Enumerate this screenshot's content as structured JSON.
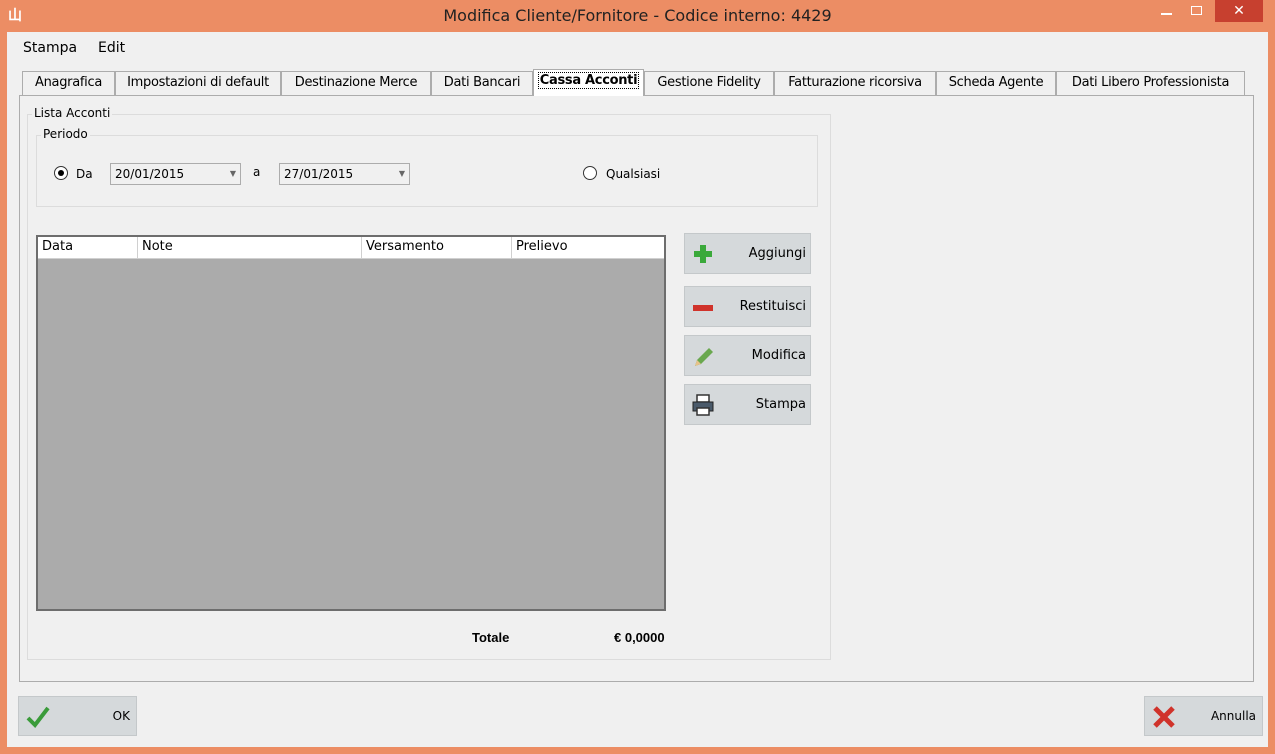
{
  "window": {
    "title": "Modifica Cliente/Fornitore - Codice interno: 4429",
    "icon_glyph": "山",
    "minimize": "minimize-icon",
    "maximize": "maximize-icon",
    "close_glyph": "✕"
  },
  "menu": {
    "items": [
      "Stampa",
      "Edit"
    ]
  },
  "tabs": [
    "Anagrafica",
    "Impostazioni di default",
    "Destinazione Merce",
    "Dati Bancari",
    "Cassa Acconti",
    "Gestione Fidelity",
    "Fatturazione ricorsiva",
    "Scheda Agente",
    "Dati Libero Professionista"
  ],
  "active_tab": "Cassa Acconti",
  "lista_acconti": {
    "group_title": "Lista Acconti",
    "periodo": {
      "group_title": "Periodo",
      "radio_da_label": "Da",
      "radio_da_checked": true,
      "date_from": "20/01/2015",
      "between_label": "a",
      "date_to": "27/01/2015",
      "radio_qualsiasi_label": "Qualsiasi",
      "radio_qualsiasi_checked": false
    },
    "table": {
      "columns": [
        "Data",
        "Note",
        "Versamento",
        "Prelievo"
      ],
      "rows": []
    },
    "buttons": {
      "aggiungi": "Aggiungi",
      "restituisci": "Restituisci",
      "modifica": "Modifica",
      "stampa": "Stampa"
    },
    "totale_label": "Totale",
    "totale_value": "€ 0,0000"
  },
  "footer": {
    "ok_label": "OK",
    "annulla_label": "Annulla"
  },
  "colors": {
    "titlebar": "#ec8d64",
    "close_button": "#c7402f",
    "grid_background": "#ababab",
    "button_background": "#d5d9db"
  }
}
